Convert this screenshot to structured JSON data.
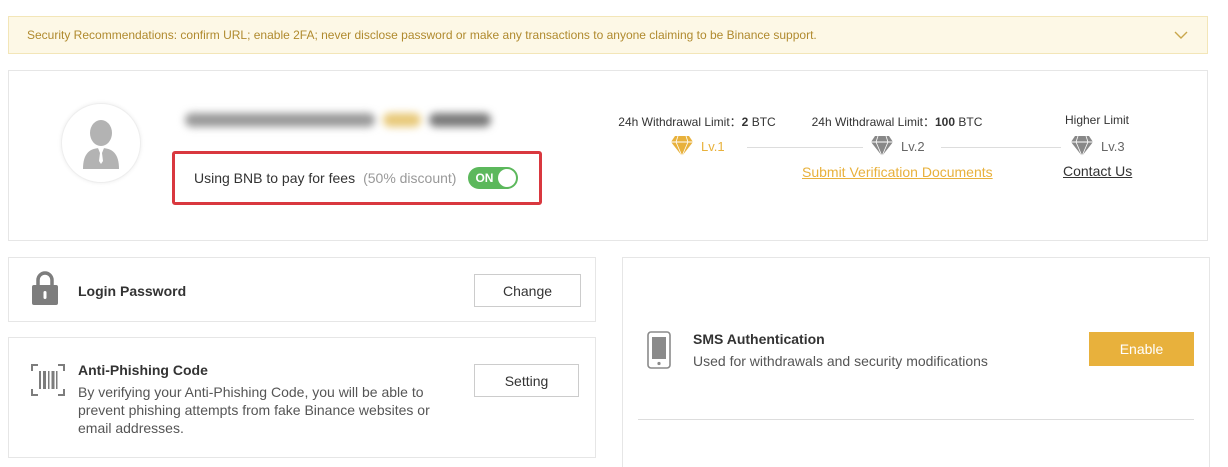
{
  "banner": {
    "text": "Security Recommendations: confirm URL; enable 2FA; never disclose password or make any transactions to anyone claiming to be Binance support."
  },
  "profile": {
    "bnb_label": "Using BNB to pay for fees",
    "bnb_discount": "(50% discount)",
    "toggle_state": "ON"
  },
  "levels": [
    {
      "limit_label": "24h Withdrawal Limit：",
      "limit_value": "2",
      "limit_unit": " BTC",
      "level": "Lv.1",
      "color": "#e8b13c"
    },
    {
      "limit_label": "24h Withdrawal Limit：",
      "limit_value": "100",
      "limit_unit": " BTC",
      "level": "Lv.2",
      "color": "#888888"
    },
    {
      "limit_label": "Higher Limit",
      "level": "Lv.3",
      "color": "#888888"
    }
  ],
  "links": {
    "submit_docs": "Submit Verification Documents",
    "contact_us": "Contact Us"
  },
  "login_password": {
    "title": "Login Password",
    "button": "Change"
  },
  "anti_phishing": {
    "title": "Anti-Phishing Code",
    "desc_line1": "By verifying your Anti-Phishing Code, you will be able to",
    "desc_line2": "prevent phishing attempts from fake Binance websites or",
    "desc_line3": "email addresses.",
    "button": "Setting"
  },
  "sms": {
    "title": "SMS Authentication",
    "desc": "Used for withdrawals and security modifications",
    "button": "Enable"
  },
  "colors": {
    "accent": "#e8b13c",
    "highlight_border": "#d9383f",
    "toggle_on": "#5cb85c"
  }
}
